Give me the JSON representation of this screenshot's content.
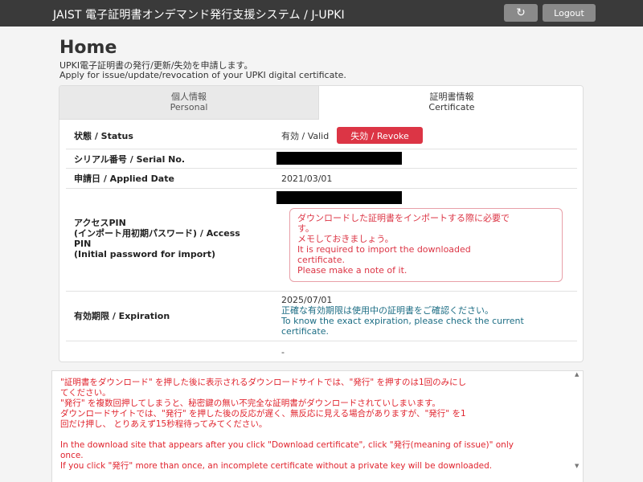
{
  "header": {
    "title": "JAIST 電子証明書オンデマンド発行支援システム / J-UPKI",
    "refresh_icon": "↻",
    "logout_label": "Logout"
  },
  "page": {
    "title": "Home",
    "intro_ja": "UPKI電子証明書の発行/更新/失効を申請します。",
    "intro_en": "Apply for issue/update/revocation of your UPKI digital certificate."
  },
  "tabs": {
    "personal_ja": "個人情報",
    "personal_en": "Personal",
    "certificate_ja": "証明書情報",
    "certificate_en": "Certificate"
  },
  "certificate": {
    "status_label": "状態 / Status",
    "status_value": "有効 / Valid",
    "revoke_label": "失効 / Revoke",
    "serial_label": "シリアル番号 / Serial No.",
    "applied_label": "申請日 / Applied Date",
    "applied_value": "2021/03/01",
    "pin_label_1": "アクセスPIN",
    "pin_label_2": "(インポート用初期パスワード) / Access",
    "pin_label_3": "PIN",
    "pin_label_4": "(Initial password for import)",
    "pin_note_1": "ダウンロードした証明書をインポートする際に必要で",
    "pin_note_2": "す。",
    "pin_note_3": "メモしておきましょう。",
    "pin_note_4": "It is required to import the downloaded",
    "pin_note_5": "certificate.",
    "pin_note_6": "Please make a note of it.",
    "expiration_label": "有効期限 / Expiration",
    "expiration_value": "2025/07/01",
    "exp_note_1": "正確な有効期限は使用中の証明書をご確認ください。",
    "exp_note_2": "To know the exact expiration, please check the current",
    "exp_note_3": "certificate.",
    "extra_value": "-"
  },
  "notice": {
    "line1": "\"証明書をダウンロード\" を押した後に表示されるダウンロードサイトでは、\"発行\" を押すのは1回のみにし",
    "line2": "てください。",
    "line3": "\"発行\" を複数回押してしまうと、秘密鍵の無い不完全な証明書がダウンロードされていしまいます。",
    "line4": "ダウンロードサイトでは、\"発行\" を押した後の反応が遅く、無反応に見える場合がありますが、\"発行\" を1",
    "line5": "回だけ押し、 とりあえず15秒程待ってみてください。",
    "line6": "In the download site that appears after you click \"Download certificate\", click \"発行(meaning of issue)\" only",
    "line7": "once.",
    "line8": "If you click \"発行\" more than once, an incomplete certificate without a private key will be downloaded."
  },
  "colors": {
    "navbar": "#3a3a3a",
    "revoke": "#dc3545",
    "notice_text": "#e0242e",
    "info_text": "#1c6d84"
  }
}
